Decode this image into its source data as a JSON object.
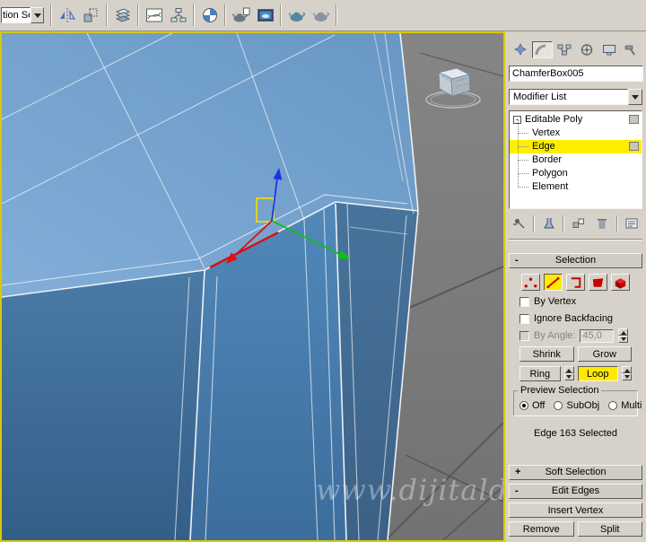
{
  "colors": {
    "panel_bg": "#d6d2c9",
    "highlight_yellow": "#ffee00",
    "selected_edge_red": "#d41111",
    "viewport_border_yellow": "#d9c900",
    "box_top_blue": "#78a5d1",
    "box_front_blue": "#4a81b2",
    "gizmo_x": "#e01010",
    "gizmo_y": "#10c010",
    "gizmo_z": "#1a35e8"
  },
  "ui": {
    "collapse_glyph": "-",
    "expand_glyph": "+"
  },
  "toolbar": {
    "selection_dropdown_value": "tion Se",
    "icons": [
      "mirror",
      "align",
      "layer-manager",
      "curve-editor",
      "schematic-view",
      "material-editor",
      "render-setup",
      "rendered-frame-window",
      "render-production",
      "render-iterative"
    ]
  },
  "viewport": {
    "watermark": "www.dijitalde"
  },
  "command_panel": {
    "tabs": [
      "create",
      "modify",
      "hierarchy",
      "motion",
      "display",
      "utilities"
    ],
    "active_tab": "modify",
    "object_name": "ChamferBox005",
    "modifier_list_label": "Modifier List",
    "modifier_stack": {
      "root": "Editable Poly",
      "items": [
        "Vertex",
        "Edge",
        "Border",
        "Polygon",
        "Element"
      ],
      "selected_item": "Edge"
    },
    "selection_rollout": {
      "title": "Selection",
      "by_vertex_label": "By Vertex",
      "ignore_backfacing_label": "Ignore Backfacing",
      "by_angle_label": "By Angle:",
      "by_angle_value": "45,0",
      "shrink_label": "Shrink",
      "grow_label": "Grow",
      "ring_label": "Ring",
      "loop_label": "Loop",
      "preview_title": "Preview Selection",
      "preview_options": [
        "Off",
        "SubObj",
        "Multi"
      ],
      "preview_selected": "Off",
      "status_text": "Edge 163 Selected"
    },
    "soft_selection_title": "Soft Selection",
    "edit_edges": {
      "title": "Edit Edges",
      "insert_vertex_label": "Insert Vertex",
      "remove_label": "Remove",
      "split_label": "Split"
    }
  }
}
